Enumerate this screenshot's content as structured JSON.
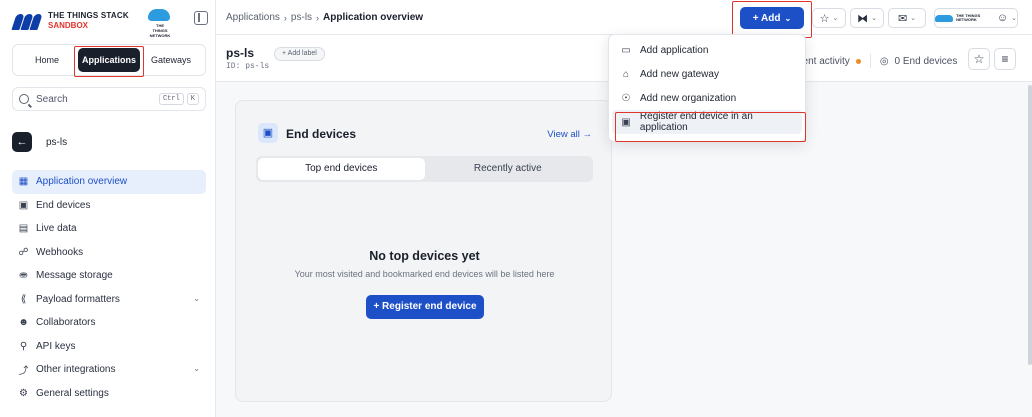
{
  "brand": {
    "line1": "THE THINGS STACK",
    "line2": "SANDBOX",
    "network_logo_text": "THE THINGS NETWORK"
  },
  "nav_tabs": [
    {
      "label": "Home"
    },
    {
      "label": "Applications"
    },
    {
      "label": "Gateways"
    }
  ],
  "search": {
    "placeholder": "Search",
    "key1": "Ctrl",
    "key2": "K"
  },
  "app": {
    "name": "ps-ls",
    "id_label": "ID: ps-ls",
    "add_label": "+ Add label"
  },
  "sidebar_items": [
    {
      "label": "Application overview",
      "icon": "grid-icon"
    },
    {
      "label": "End devices",
      "icon": "chip-icon"
    },
    {
      "label": "Live data",
      "icon": "list-icon"
    },
    {
      "label": "Webhooks",
      "icon": "webhook-icon"
    },
    {
      "label": "Message storage",
      "icon": "database-icon"
    },
    {
      "label": "Payload formatters",
      "icon": "brackets-icon"
    },
    {
      "label": "Collaborators",
      "icon": "users-icon"
    },
    {
      "label": "API keys",
      "icon": "key-icon"
    },
    {
      "label": "Other integrations",
      "icon": "integrations-icon"
    },
    {
      "label": "General settings",
      "icon": "gear-icon"
    }
  ],
  "breadcrumb": {
    "item1": "Applications",
    "item2": "ps-ls",
    "current": "Application overview"
  },
  "header": {
    "add_button": "+ Add"
  },
  "activity": {
    "recent": "ecent activity",
    "devices": "0 End devices"
  },
  "card": {
    "title": "End devices",
    "view_all": "View all →",
    "tab1": "Top end devices",
    "tab2": "Recently active",
    "empty_title": "No top devices yet",
    "empty_sub": "Your most visited and bookmarked end devices will be listed here",
    "register_button": "+ Register end device"
  },
  "dropdown": [
    {
      "label": "Add application",
      "icon": "application-icon"
    },
    {
      "label": "Add new gateway",
      "icon": "gateway-icon"
    },
    {
      "label": "Add new organization",
      "icon": "organization-icon"
    },
    {
      "label": "Register end device in an application",
      "icon": "chip-icon"
    }
  ],
  "colors": {
    "accent": "#1d4fc7",
    "highlight": "#e0352b",
    "sidebar_active_bg": "#e7effc"
  }
}
